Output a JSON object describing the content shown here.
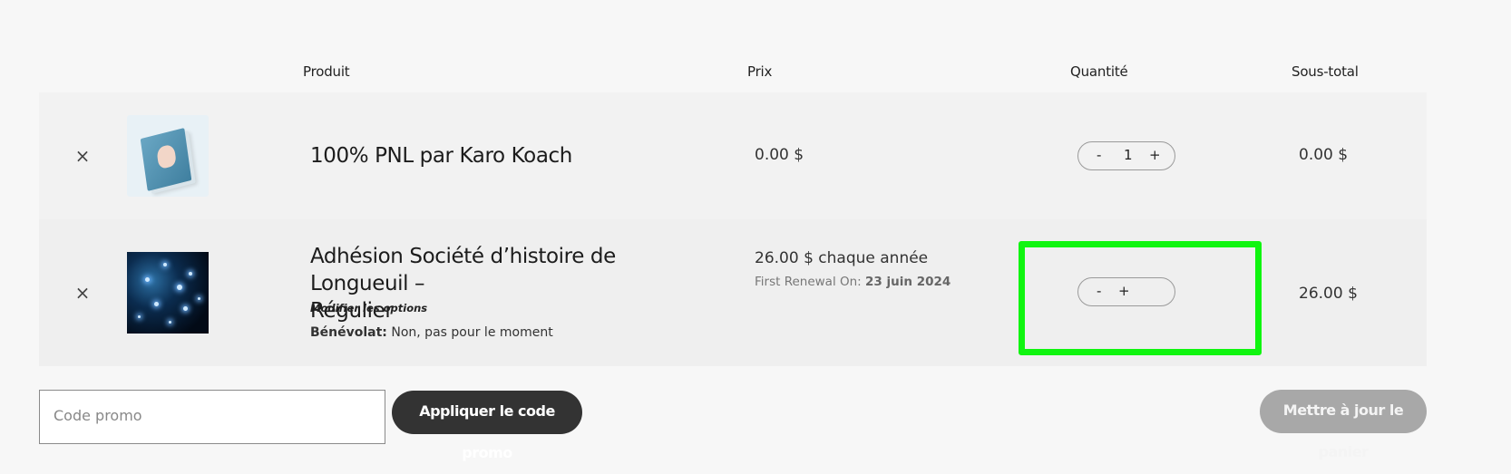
{
  "table_header": {
    "product": "Produit",
    "price": "Prix",
    "quantity": "Quantité",
    "subtotal": "Sous-total"
  },
  "cart_items": [
    {
      "remove": "×",
      "title": "100% PNL par Karo Koach",
      "price": "0.00 $",
      "qty_minus": "-",
      "qty_value": "1",
      "qty_plus": "+",
      "subtotal": "0.00 $"
    },
    {
      "remove": "×",
      "title_line1": "Adhésion Société d’histoire de Longueuil –",
      "title_line2": "Régulier",
      "edit_options": "Modifier les options",
      "volunteer_label": "Bénévolat:",
      "volunteer_value": "Non, pas pour le moment",
      "price": "26.00 $ chaque année",
      "renewal_label": "First Renewal On:",
      "renewal_date": "23 juin 2024",
      "qty_minus": "-",
      "qty_plus": "+",
      "subtotal": "26.00 $"
    }
  ],
  "promo": {
    "placeholder": "Code promo",
    "apply_label": "Appliquer le code promo"
  },
  "update_cart_label": "Mettre à jour le panier",
  "colors": {
    "highlight": "#10f510",
    "apply_button": "#333333",
    "update_button_disabled": "#a8a8a8"
  }
}
